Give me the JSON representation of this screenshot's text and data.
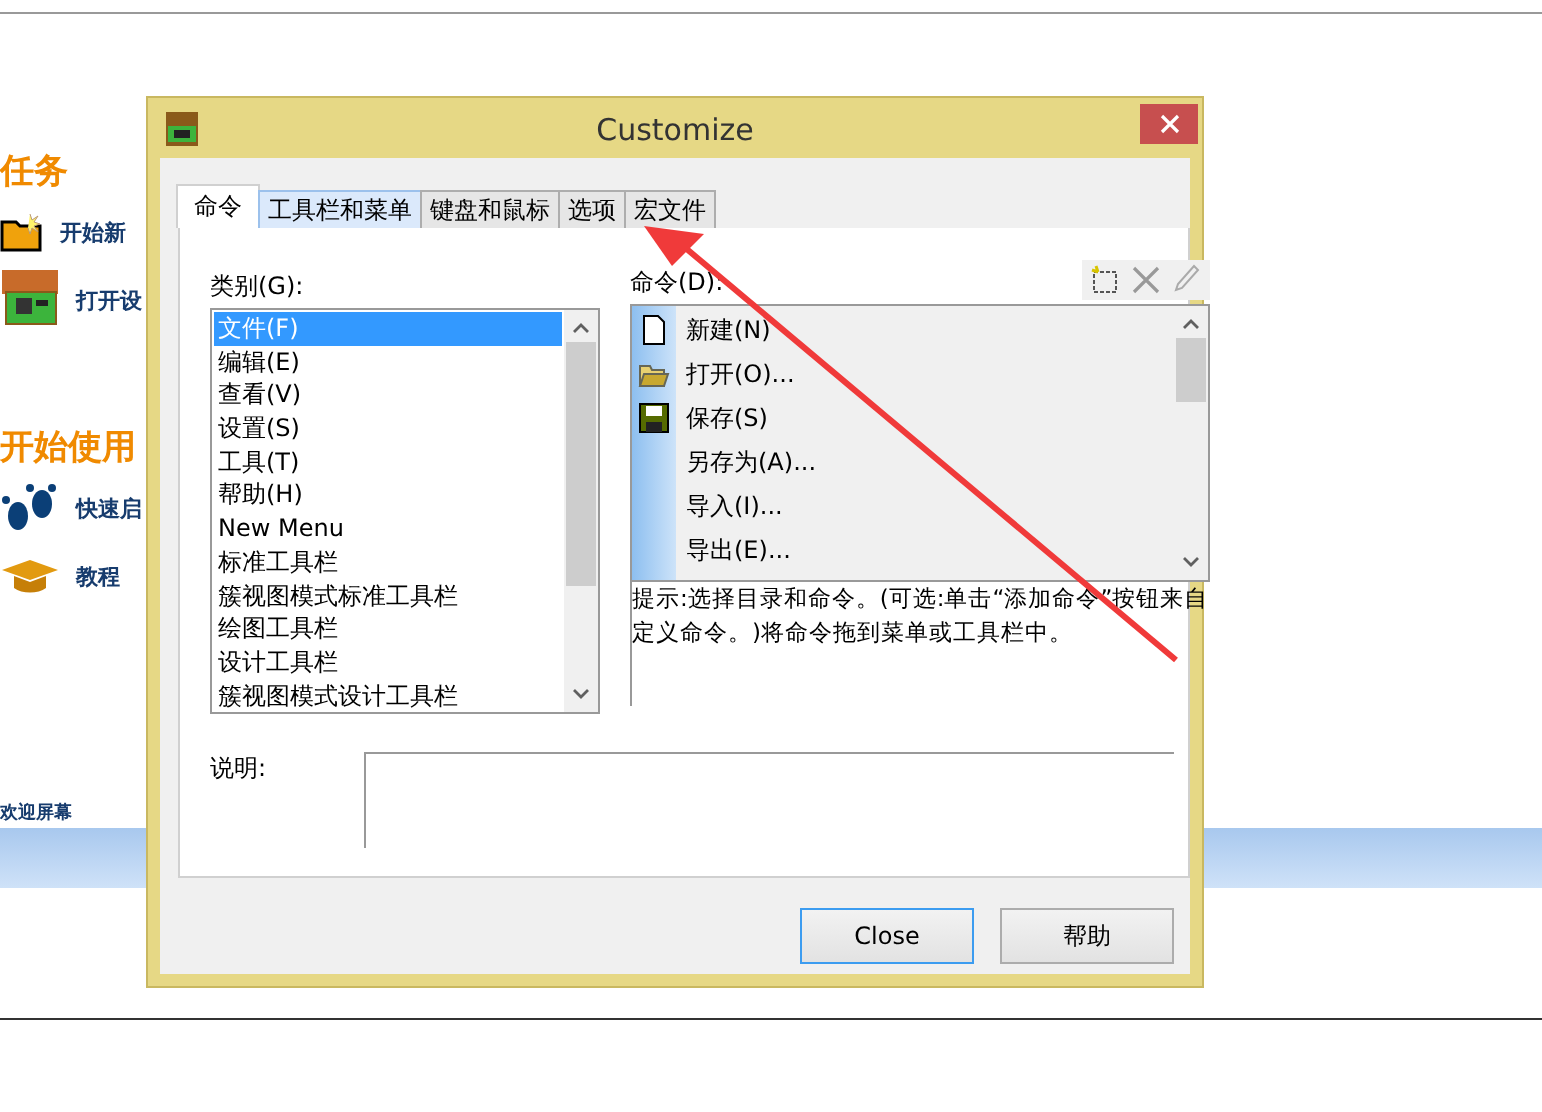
{
  "background_app": {
    "sections": [
      {
        "title": "任务",
        "items": [
          {
            "label": "开始新",
            "kind": "folder"
          },
          {
            "label": "打开设",
            "kind": "board"
          }
        ]
      },
      {
        "title": "开始使用",
        "items": [
          {
            "label": "快速启",
            "kind": "footprints"
          },
          {
            "label": "教程",
            "kind": "cap"
          }
        ]
      }
    ],
    "footer_link": "欢迎屏幕"
  },
  "dialog": {
    "title": "Customize",
    "tabs": [
      {
        "label": "命令",
        "selected": true
      },
      {
        "label": "工具栏和菜单",
        "selected": false
      },
      {
        "label": "键盘和鼠标",
        "selected": false
      },
      {
        "label": "选项",
        "selected": false
      },
      {
        "label": "宏文件",
        "selected": false
      }
    ],
    "categories": {
      "label": "类别(G):",
      "items": [
        {
          "label": "文件(F)",
          "selected": true
        },
        {
          "label": "编辑(E)",
          "selected": false
        },
        {
          "label": "查看(V)",
          "selected": false
        },
        {
          "label": "设置(S)",
          "selected": false
        },
        {
          "label": "工具(T)",
          "selected": false
        },
        {
          "label": "帮助(H)",
          "selected": false
        },
        {
          "label": "New Menu",
          "selected": false
        },
        {
          "label": "标准工具栏",
          "selected": false
        },
        {
          "label": "簇视图模式标准工具栏",
          "selected": false
        },
        {
          "label": "绘图工具栏",
          "selected": false
        },
        {
          "label": "设计工具栏",
          "selected": false
        },
        {
          "label": "簇视图模式设计工具栏",
          "selected": false
        }
      ]
    },
    "commands": {
      "label": "命令(D):",
      "items": [
        {
          "label": "新建(N)",
          "kind": "page"
        },
        {
          "label": "打开(O)...",
          "kind": "folder"
        },
        {
          "label": "保存(S)",
          "kind": "disk"
        },
        {
          "label": "另存为(A)...",
          "kind": "plain"
        },
        {
          "label": "导入(I)...",
          "kind": "plain"
        },
        {
          "label": "导出(E)...",
          "kind": "plain"
        }
      ]
    },
    "hint": "提示:选择目录和命令。(可选:单击“添加命令”按钮来自定义命令。)将命令拖到菜单或工具栏中。",
    "description": {
      "label": "说明:"
    },
    "buttons": [
      {
        "label": "Close",
        "default": true
      },
      {
        "label": "帮助",
        "default": false
      }
    ]
  }
}
